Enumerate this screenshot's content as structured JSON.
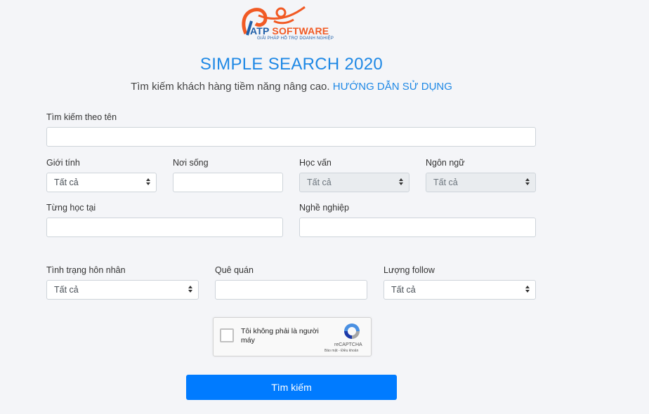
{
  "logo": {
    "name_part1": "ATP",
    "name_part2": "SOFTWARE",
    "tagline": "GIẢI PHÁP HỖ TRỢ DOANH NGHIỆP",
    "colors": {
      "blue": "#1f5fa8",
      "orange": "#f15a24"
    }
  },
  "header": {
    "title": "SIMPLE SEARCH 2020",
    "subtitle": "Tìm kiếm khách hàng tiềm năng nâng cao.",
    "guide_link": "HƯỚNG DẪN SỬ DỤNG"
  },
  "form": {
    "name_label": "Tìm kiếm theo tên",
    "gender": {
      "label": "Giới tính",
      "value": "Tất cả"
    },
    "residence": {
      "label": "Nơi sống"
    },
    "education": {
      "label": "Học vấn",
      "value": "Tất cả"
    },
    "language": {
      "label": "Ngôn ngữ",
      "value": "Tất cả"
    },
    "studied_at": {
      "label": "Từng học tại"
    },
    "occupation": {
      "label": "Nghề nghiệp"
    },
    "marital": {
      "label": "Tình trạng hôn nhân",
      "value": "Tất cả"
    },
    "hometown": {
      "label": "Quê quán"
    },
    "follow": {
      "label": "Lượng follow",
      "value": "Tất cả"
    }
  },
  "captcha": {
    "label": "Tôi không phải là người máy",
    "brand": "reCAPTCHA",
    "links": "Bảo mật - Điều khoản"
  },
  "submit_label": "Tìm kiếm",
  "colors": {
    "accent": "#007bff",
    "title": "#1e88e5"
  }
}
